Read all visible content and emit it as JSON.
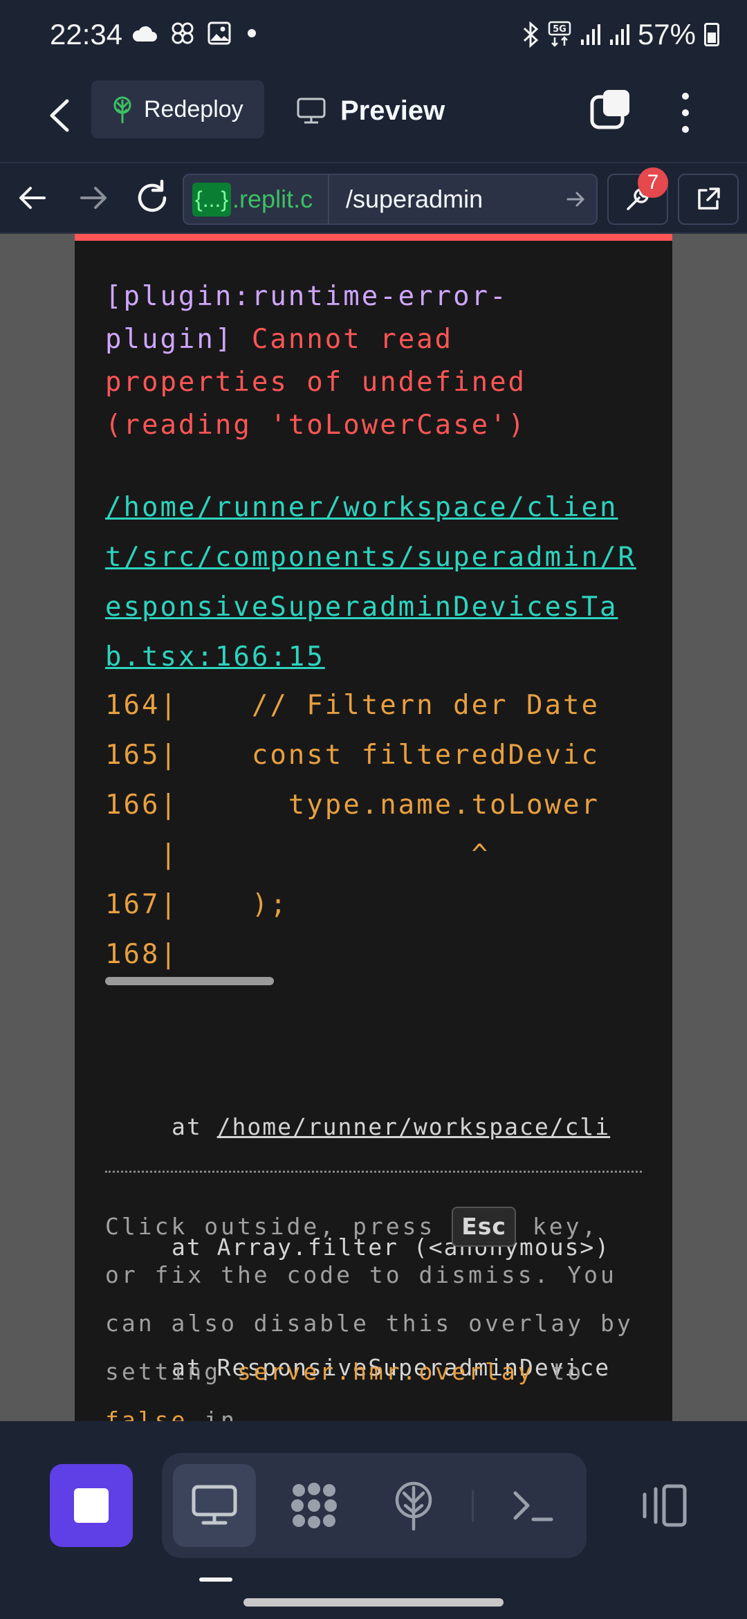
{
  "status_bar": {
    "time": "22:34",
    "battery_percent": "57%",
    "left_icons": [
      "cloud-icon",
      "pinwheel-icon",
      "image-icon",
      "dot-icon"
    ],
    "right_icons": [
      "bluetooth-icon",
      "5g-icon",
      "signal-icon",
      "signal-icon",
      "battery-icon"
    ]
  },
  "app_bar": {
    "redeploy_label": "Redeploy",
    "preview_label": "Preview"
  },
  "browser": {
    "url_badge": "{...}",
    "url_domain": ".replit.c",
    "url_path": "/superadmin",
    "devtools_badge_count": "7"
  },
  "error_overlay": {
    "plugin_label": "[plugin:runtime-error-plugin]",
    "message": " Cannot read properties of undefined (reading 'toLowerCase')",
    "file_path": "/home/runner/workspace/client/src/components/superadmin/ResponsiveSuperadminDevicesTab.tsx:166:15",
    "code_lines": [
      "164|    // Filtern der Date",
      "165|    const filteredDevic",
      "166|      type.name.toLower",
      "   |                ^",
      "167|    );",
      "168|"
    ],
    "stack_lines": [
      {
        "prefix": "at ",
        "text": "/home/runner/workspace/cli",
        "underline": true
      },
      {
        "prefix": "at ",
        "text": "Array.filter (<anonymous>)",
        "underline": false
      },
      {
        "prefix": "at ",
        "text": "ResponsiveSuperadminDevice",
        "underline": false
      }
    ],
    "tip_part1": "Click outside, press ",
    "tip_key": "Esc",
    "tip_part2": " key, or fix the code to dismiss. You can also disable this overlay by setting ",
    "tip_setting": "server.hmr.overlay",
    "tip_part3": " to ",
    "tip_false": "false",
    "tip_part4": " in"
  },
  "bottom_toolbar": {
    "tools": [
      "preview-icon",
      "workspace-apps-icon",
      "deployments-icon",
      "shell-icon"
    ],
    "active_tool": "preview-icon"
  },
  "colors": {
    "background": "#1c2333",
    "accent_purple": "#5f3fe6",
    "error_red": "#ff5555",
    "link_teal": "#2dd4bf",
    "code_orange": "#e8a040",
    "plugin_violet": "#cfa6ff",
    "url_green": "#3cc063"
  }
}
